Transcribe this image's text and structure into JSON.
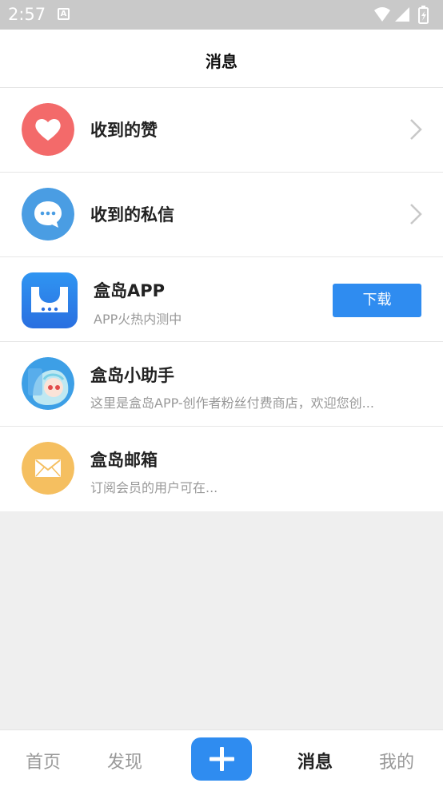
{
  "status_bar": {
    "time": "2:57",
    "a_icon": "A"
  },
  "header": {
    "title": "消息"
  },
  "items": [
    {
      "title": "收到的赞",
      "icon": "heart-icon",
      "color": "#f36a6a"
    },
    {
      "title": "收到的私信",
      "icon": "chat-bubble-icon",
      "color": "#4a9de3"
    },
    {
      "title": "盒岛APP",
      "subtitle": "APP火热内测中",
      "button": "下载",
      "icon": "app-logo-icon"
    },
    {
      "title": "盒岛小助手",
      "subtitle": "这里是盒岛APP-创作者粉丝付费商店，欢迎您创...",
      "icon": "assistant-avatar-icon"
    },
    {
      "title": "盒岛邮箱",
      "subtitle": "订阅会员的用户可在...",
      "icon": "mail-icon",
      "color": "#f5bf60"
    }
  ],
  "bottom_nav": {
    "home": "首页",
    "discover": "发现",
    "messages": "消息",
    "mine": "我的",
    "active": "消息"
  },
  "colors": {
    "accent": "#2f8cf0",
    "status_bar": "#c9c9c9",
    "background": "#efefef"
  }
}
